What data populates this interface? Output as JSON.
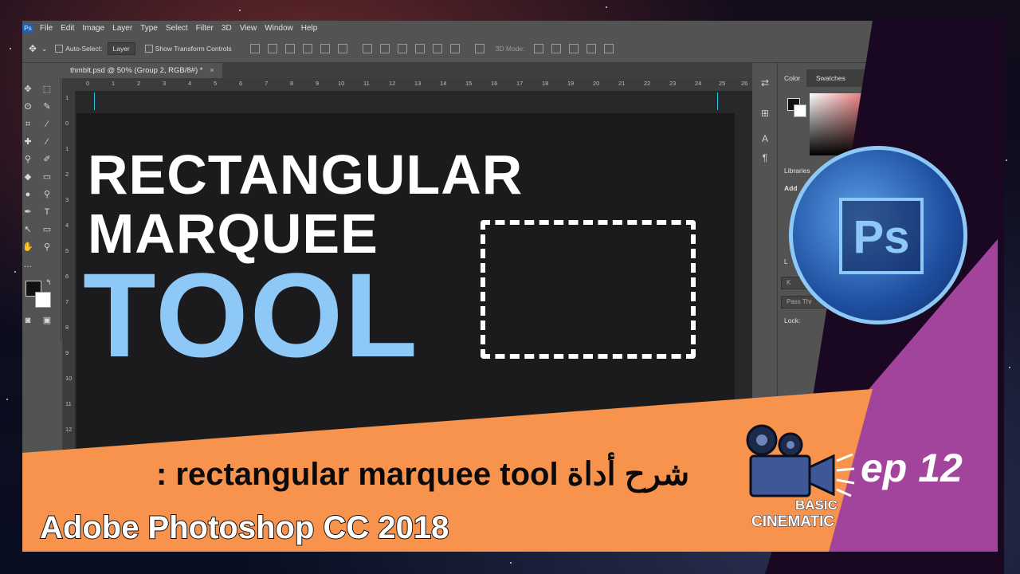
{
  "menubar": {
    "app_icon": "photoshop-app-icon",
    "items": [
      "File",
      "Edit",
      "Image",
      "Layer",
      "Type",
      "Select",
      "Filter",
      "3D",
      "View",
      "Window",
      "Help"
    ]
  },
  "options": {
    "auto_select_label": "Auto-Select:",
    "auto_select_value": "Layer",
    "show_transform_label": "Show Transform Controls",
    "mode_label": "3D Mode:"
  },
  "document": {
    "tab_title": "thmblt.psd @ 50% (Group 2, RGB/8#) *",
    "tab_close": "×",
    "ruler_ticks": [
      "0",
      "1",
      "2",
      "3",
      "4",
      "5",
      "6",
      "7",
      "8",
      "9",
      "10",
      "11",
      "12",
      "13",
      "14",
      "15",
      "16",
      "17",
      "18",
      "19",
      "20",
      "21",
      "22",
      "23",
      "24",
      "25",
      "26"
    ]
  },
  "canvas_text": {
    "line1": "RECTANGULAR",
    "line2": "MARQUEE",
    "line3": "TOOL"
  },
  "panels": {
    "color_tab": "Color",
    "swatches_tab": "Swatches",
    "libraries_label": "Libraries",
    "add_label": "Add",
    "layers_label": "L",
    "kind_label": "K",
    "blend_label": "Pass Thr",
    "lock_label": "Lock:"
  },
  "overlay": {
    "subtitle": ": rectangular marquee tool شرح أداة",
    "product": "Adobe Photoshop CC 2018",
    "episode": "ep 12",
    "brand_line1": "BASIC",
    "brand_line2": "CINEMATIC",
    "logo_text": "Ps"
  },
  "colors": {
    "accent_blue": "#8ec8f6",
    "orange_banner": "#f7934c",
    "purple_wedge": "#a2449c",
    "ps_panel": "#535353",
    "canvas": "#1b1b1d"
  }
}
